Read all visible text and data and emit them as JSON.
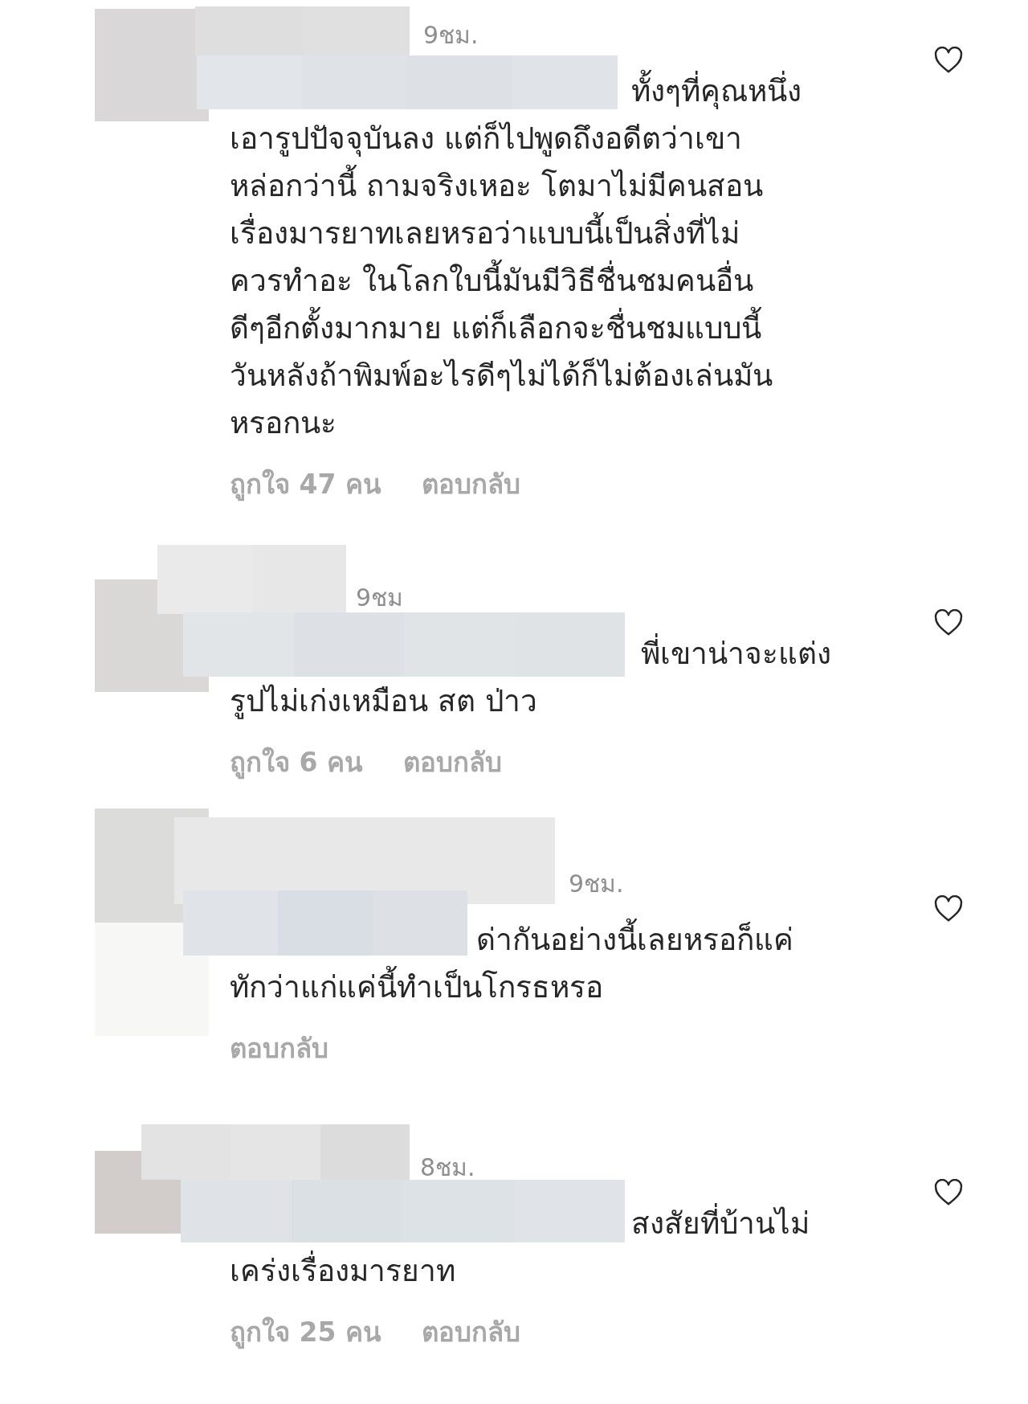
{
  "comments": [
    {
      "time": "9ชม.",
      "lines": [
        "ทั้งๆที่คุณหนึ่ง",
        "เอารูปปัจจุบันลง แต่ก็ไปพูดถึงอดีตว่าเขา",
        "หล่อกว่านี้ ถามจริงเหอะ โตมาไม่มีคนสอน",
        "เรื่องมารยาทเลยหรอว่าแบบนี้เป็นสิ่งที่ไม่",
        "ควรทำอะ ในโลกใบนี้มันมีวิธีชื่นชมคนอื่น",
        "ดีๆอีกตั้งมากมาย แต่ก็เลือกจะชื่นชมแบบนี้",
        "วันหลังถ้าพิมพ์อะไรดีๆไม่ได้ก็ไม่ต้องเล่นมัน",
        "หรอกนะ"
      ],
      "likes": "ถูกใจ 47 คน",
      "reply": "ตอบกลับ",
      "liked": false
    },
    {
      "time": "9ชม",
      "lines": [
        "พี่เขาน่าจะแต่ง",
        "รูปไม่เก่งเหมือน สต ป่าว"
      ],
      "likes": "ถูกใจ 6 คน",
      "reply": "ตอบกลับ",
      "liked": false
    },
    {
      "time": "9ชม.",
      "lines": [
        "ด่ากันอย่างนี้เลยหรอก็แค่",
        "ทักว่าแก่แค่นี้ทำเป็นโกรธหรอ"
      ],
      "reply": "ตอบกลับ",
      "liked": false
    },
    {
      "time": "8ชม.",
      "lines": [
        "สงสัยที่บ้านไม่",
        "เคร่งเรื่องมารยาท"
      ],
      "likes": "ถูกใจ 25 คน",
      "reply": "ตอบกลับ",
      "liked": false
    }
  ]
}
